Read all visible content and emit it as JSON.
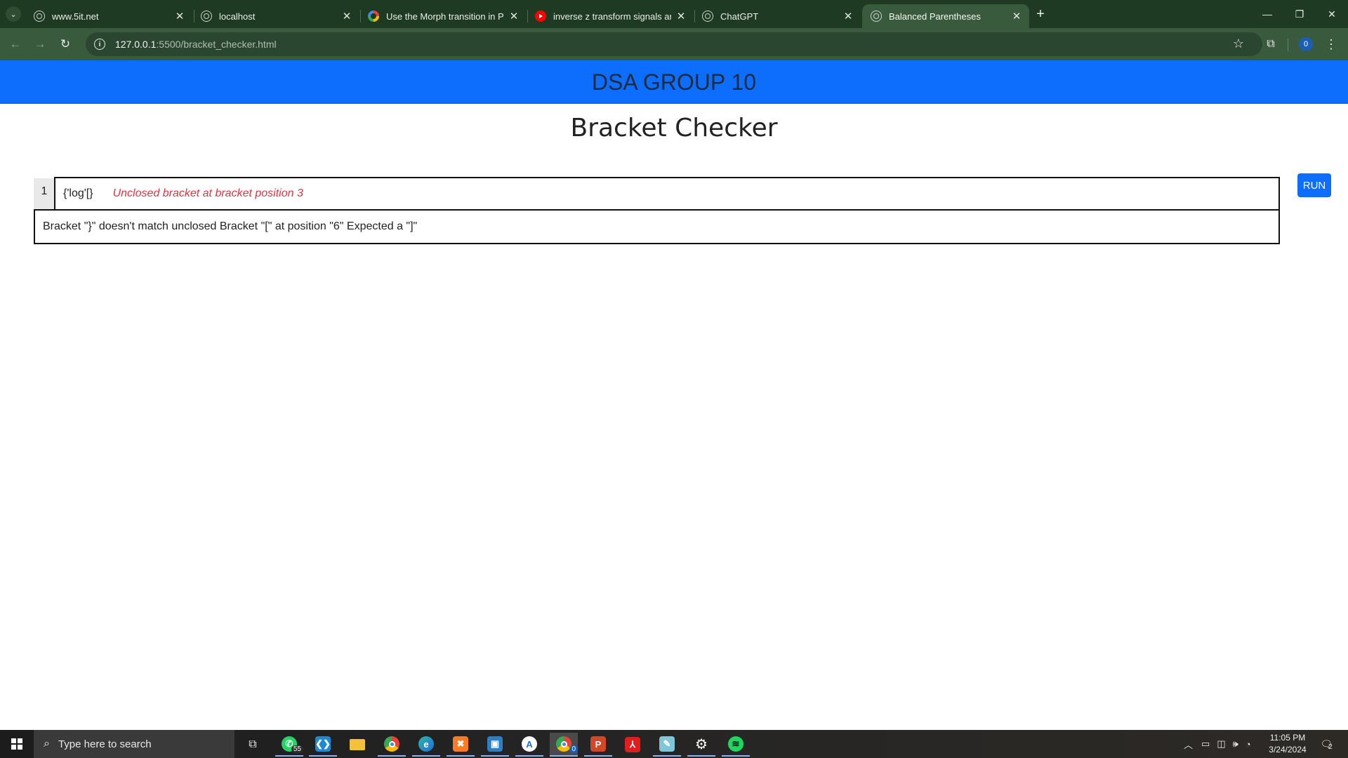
{
  "browser": {
    "tabs": [
      {
        "title": "www.5it.net",
        "favicon": "globe-icon"
      },
      {
        "title": "localhost",
        "favicon": "globe-icon"
      },
      {
        "title": "Use the Morph transition in Po",
        "favicon": "google-icon"
      },
      {
        "title": "inverse z transform signals and",
        "favicon": "youtube-icon"
      },
      {
        "title": "ChatGPT",
        "favicon": "globe-icon"
      },
      {
        "title": "Balanced Parentheses",
        "favicon": "globe-icon",
        "active": true
      }
    ],
    "address": {
      "host": "127.0.0.1",
      "path": ":5500/bracket_checker.html"
    },
    "profile_badge": "0",
    "theme_color": "#3a5a3e"
  },
  "page": {
    "banner_title": "DSA GROUP 10",
    "banner_color": "#0d6efd",
    "title": "Bracket Checker",
    "editor": {
      "line_number": "1",
      "code": "{'log'[}",
      "inline_error": "Unclosed bracket at bracket position 3"
    },
    "run_label": "RUN",
    "output": "Bracket \"}\" doesn't match unclosed Bracket \"[\" at position \"6\" Expected a \"]\""
  },
  "taskbar": {
    "search_placeholder": "Type here to search",
    "whatsapp_badge": "55",
    "chrome_badge": "0",
    "time": "11:05 PM",
    "date": "3/24/2024",
    "notifications": "2"
  }
}
